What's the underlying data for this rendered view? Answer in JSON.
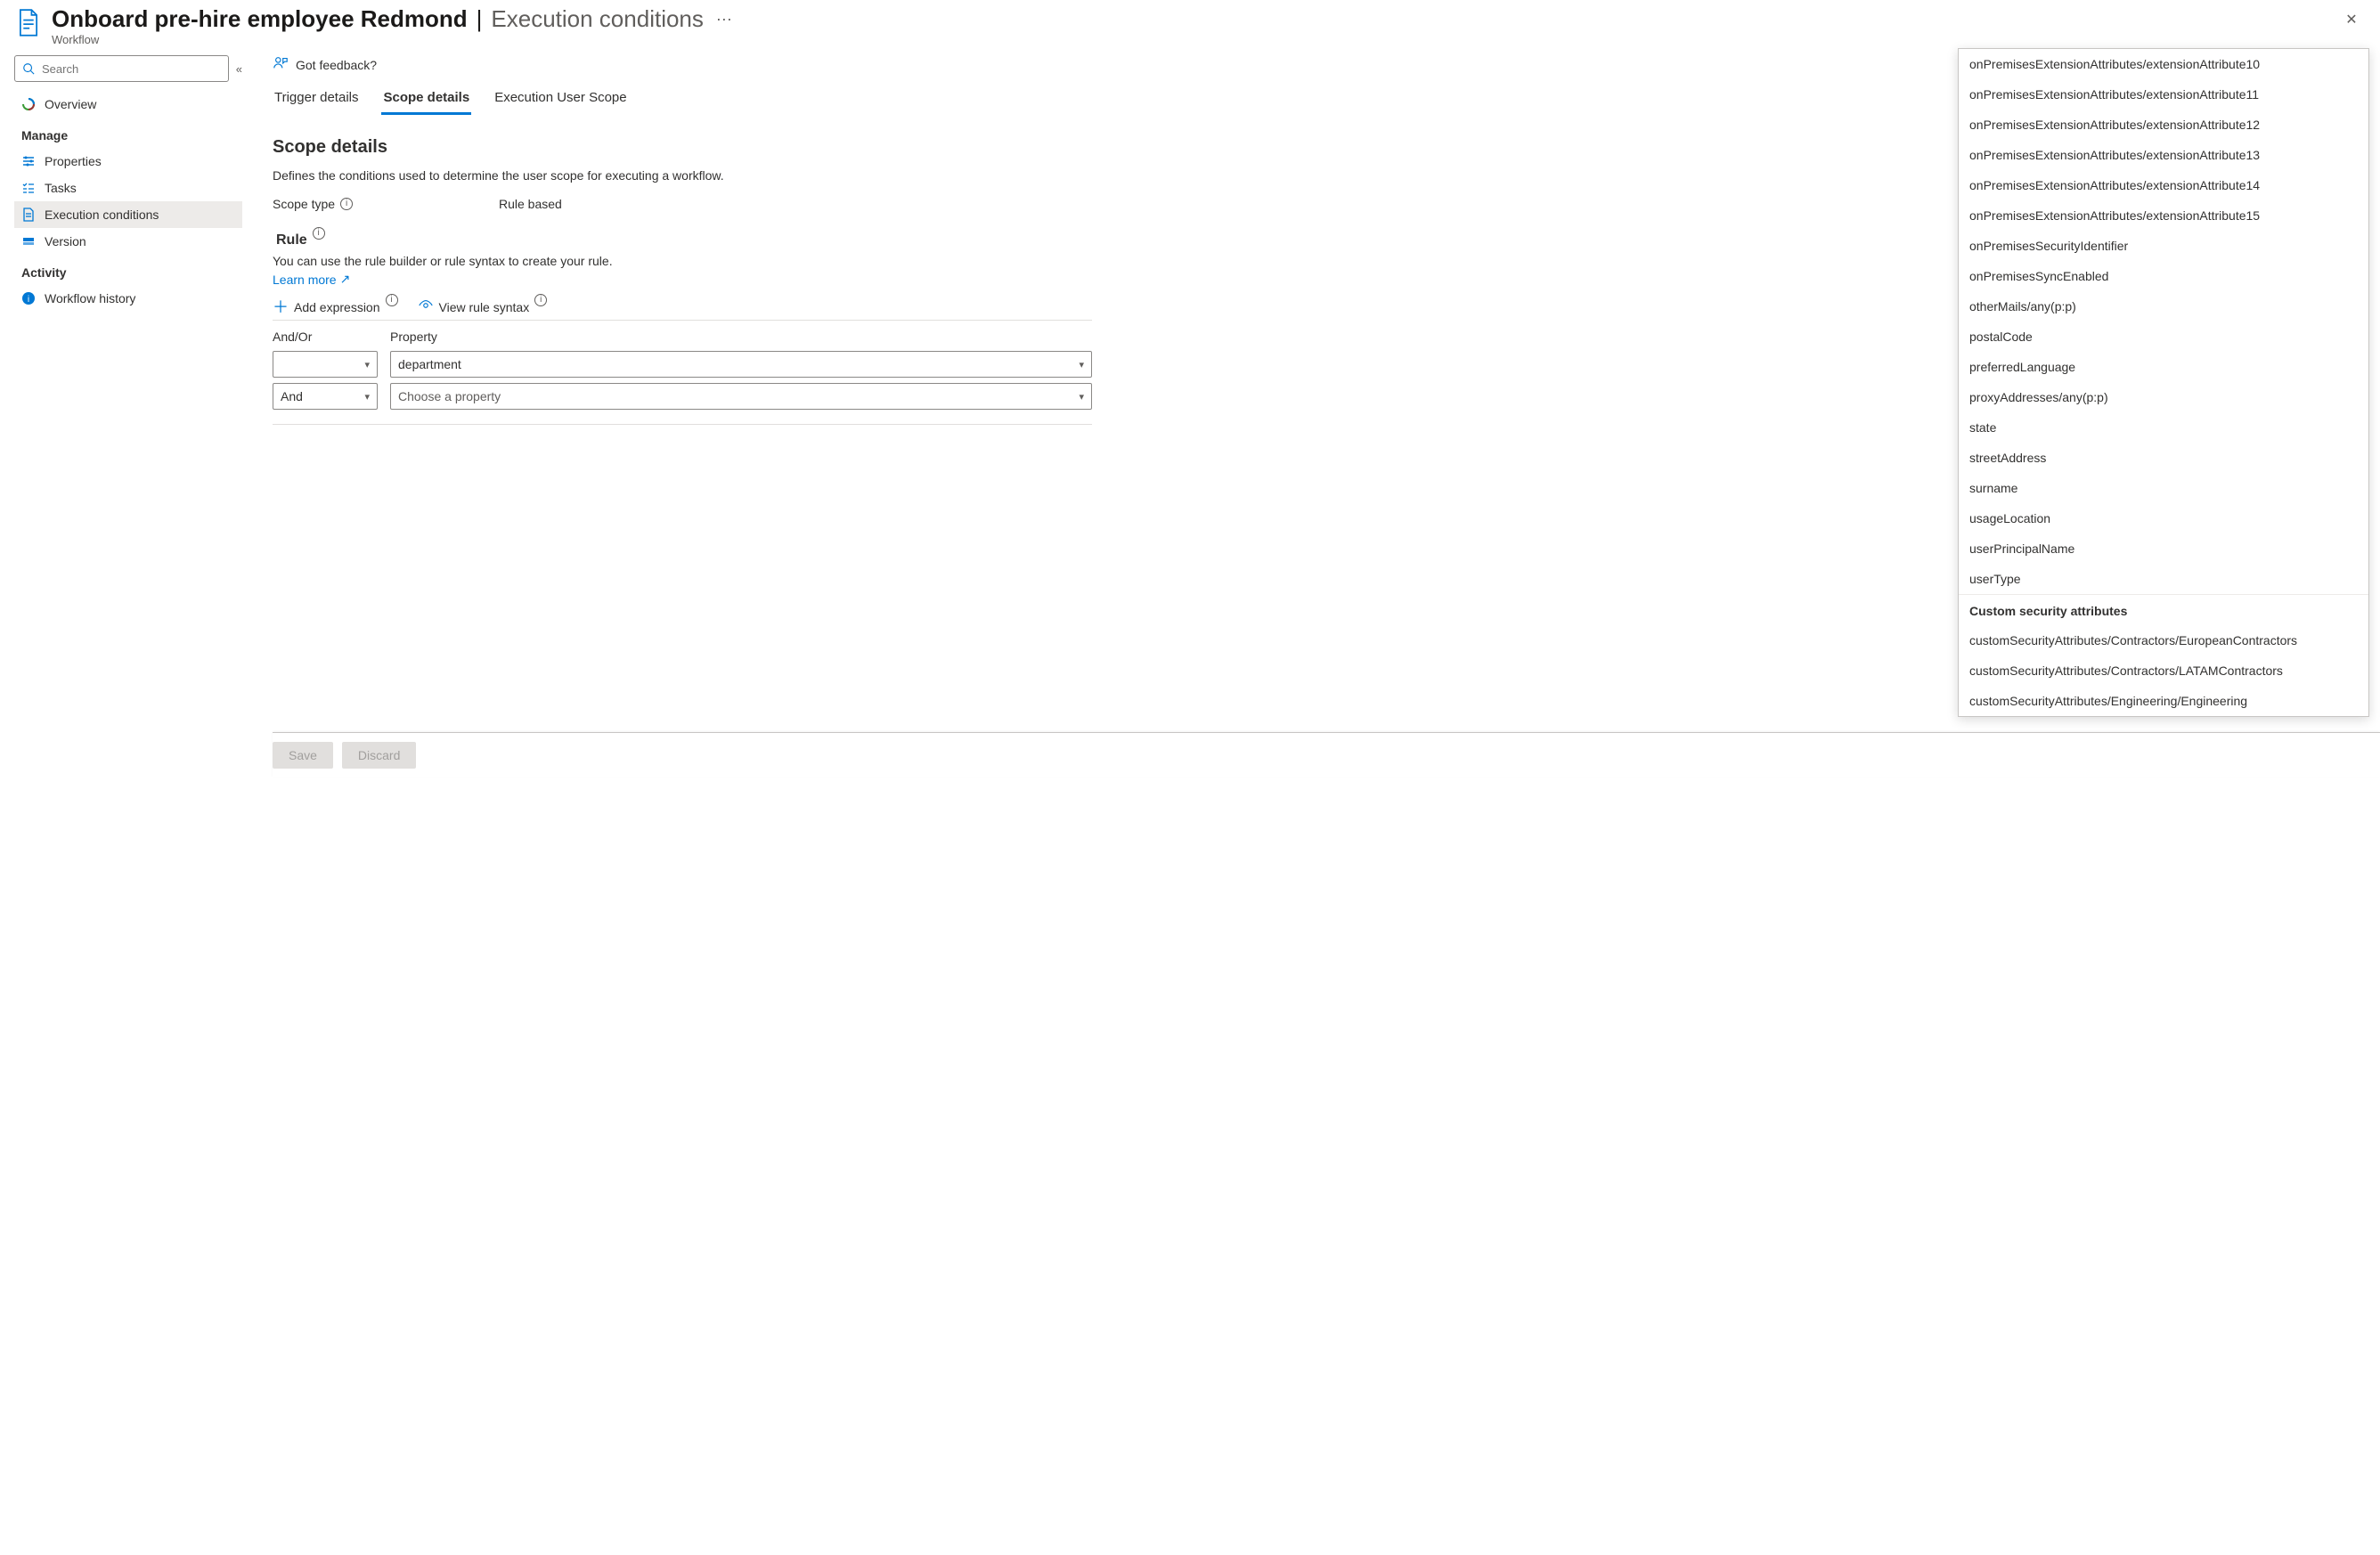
{
  "header": {
    "title_main": "Onboard pre-hire employee Redmond",
    "title_sub": "Execution conditions",
    "subtitle": "Workflow"
  },
  "sidebar": {
    "search_placeholder": "Search",
    "overview": "Overview",
    "manage_label": "Manage",
    "manage_items": {
      "properties": "Properties",
      "tasks": "Tasks",
      "execution_conditions": "Execution conditions",
      "version": "Version"
    },
    "activity_label": "Activity",
    "activity_items": {
      "workflow_history": "Workflow history"
    }
  },
  "feedback_text": "Got feedback?",
  "tabs": {
    "trigger": "Trigger details",
    "scope": "Scope details",
    "euscope": "Execution User Scope"
  },
  "scope": {
    "title": "Scope details",
    "description": "Defines the conditions used to determine the user scope for executing a workflow.",
    "scope_type_label": "Scope type",
    "scope_type_value": "Rule based",
    "rule_label": "Rule",
    "rule_desc": "You can use the rule builder or rule syntax to create your rule.",
    "learn_more": "Learn more",
    "add_expression": "Add expression",
    "view_rule_syntax": "View rule syntax"
  },
  "grid": {
    "col_andor": "And/Or",
    "col_property": "Property",
    "rows": {
      "r0_andor": "",
      "r0_prop": "department",
      "r1_andor": "And",
      "r1_prop_placeholder": "Choose a property"
    }
  },
  "footer": {
    "save": "Save",
    "discard": "Discard"
  },
  "dropdown": {
    "items0": "onPremisesExtensionAttributes/extensionAttribute10",
    "items1": "onPremisesExtensionAttributes/extensionAttribute11",
    "items2": "onPremisesExtensionAttributes/extensionAttribute12",
    "items3": "onPremisesExtensionAttributes/extensionAttribute13",
    "items4": "onPremisesExtensionAttributes/extensionAttribute14",
    "items5": "onPremisesExtensionAttributes/extensionAttribute15",
    "items6": "onPremisesSecurityIdentifier",
    "items7": "onPremisesSyncEnabled",
    "items8": "otherMails/any(p:p)",
    "items9": "postalCode",
    "items10": "preferredLanguage",
    "items11": "proxyAddresses/any(p:p)",
    "items12": "state",
    "items13": "streetAddress",
    "items14": "surname",
    "items15": "usageLocation",
    "items16": "userPrincipalName",
    "items17": "userType",
    "section_label": "Custom security attributes",
    "items18": "customSecurityAttributes/Contractors/EuropeanContractors",
    "items19": "customSecurityAttributes/Contractors/LATAMContractors",
    "items20": "customSecurityAttributes/Engineering/Engineering"
  }
}
